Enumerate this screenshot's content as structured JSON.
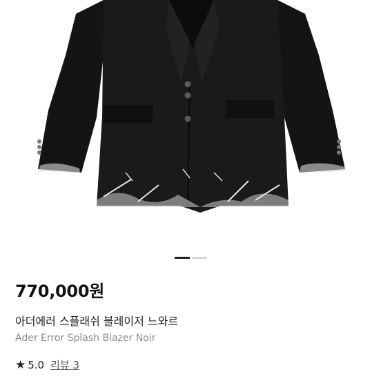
{
  "product": {
    "price": "770,000원",
    "name_ko": "아더에러 스플래쉬 블레이저 느와르",
    "name_en": "Ader Error Splash Blazer Noir",
    "rating": "5.0",
    "review_link": "리뷰 3"
  },
  "gallery": {
    "image_subject": "black-blazer-photo",
    "active_index": 1,
    "total_images": 2
  },
  "icons": {
    "rating_icon": "star-icon"
  },
  "colors": {
    "text_primary": "#111111",
    "text_secondary": "#8a8a8a",
    "indicator_active": "#222222",
    "indicator_inactive": "#d6d6d6"
  }
}
